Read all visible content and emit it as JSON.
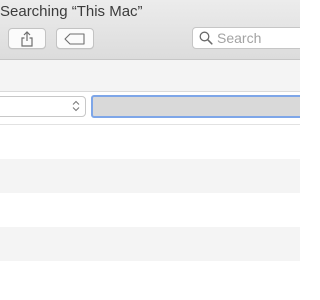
{
  "window": {
    "title": "Searching “This Mac”"
  },
  "toolbar": {
    "share_icon": "share-icon",
    "tag_icon": "tag-icon"
  },
  "search": {
    "placeholder": "Search",
    "icon": "magnifying-glass-icon"
  },
  "criteria": {
    "select_value": "",
    "field_value": ""
  },
  "results": {
    "rows": [
      {
        "striped": false
      },
      {
        "striped": true
      },
      {
        "striped": false
      },
      {
        "striped": true
      },
      {
        "striped": false
      }
    ]
  },
  "colors": {
    "focus_ring": "#7ea6e8",
    "stripe": "#f4f4f4"
  }
}
